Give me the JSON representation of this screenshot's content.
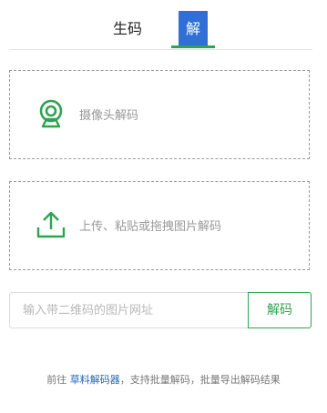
{
  "tabs": {
    "generate": "生码",
    "decode": "解码"
  },
  "camera": {
    "label": "摄像头解码",
    "icon": "webcam-icon"
  },
  "upload": {
    "label": "上传、粘贴或拖拽图片解码",
    "icon": "upload-icon"
  },
  "url": {
    "placeholder": "输入带二维码的图片网址",
    "button": "解码"
  },
  "footer": {
    "prefix": "前往 ",
    "link": "草料解码器",
    "suffix": "，支持批量解码，批量导出解码结果"
  },
  "colors": {
    "accent": "#2ea44f",
    "link": "#2366b8",
    "tab_highlight": "#2f6fd6"
  }
}
